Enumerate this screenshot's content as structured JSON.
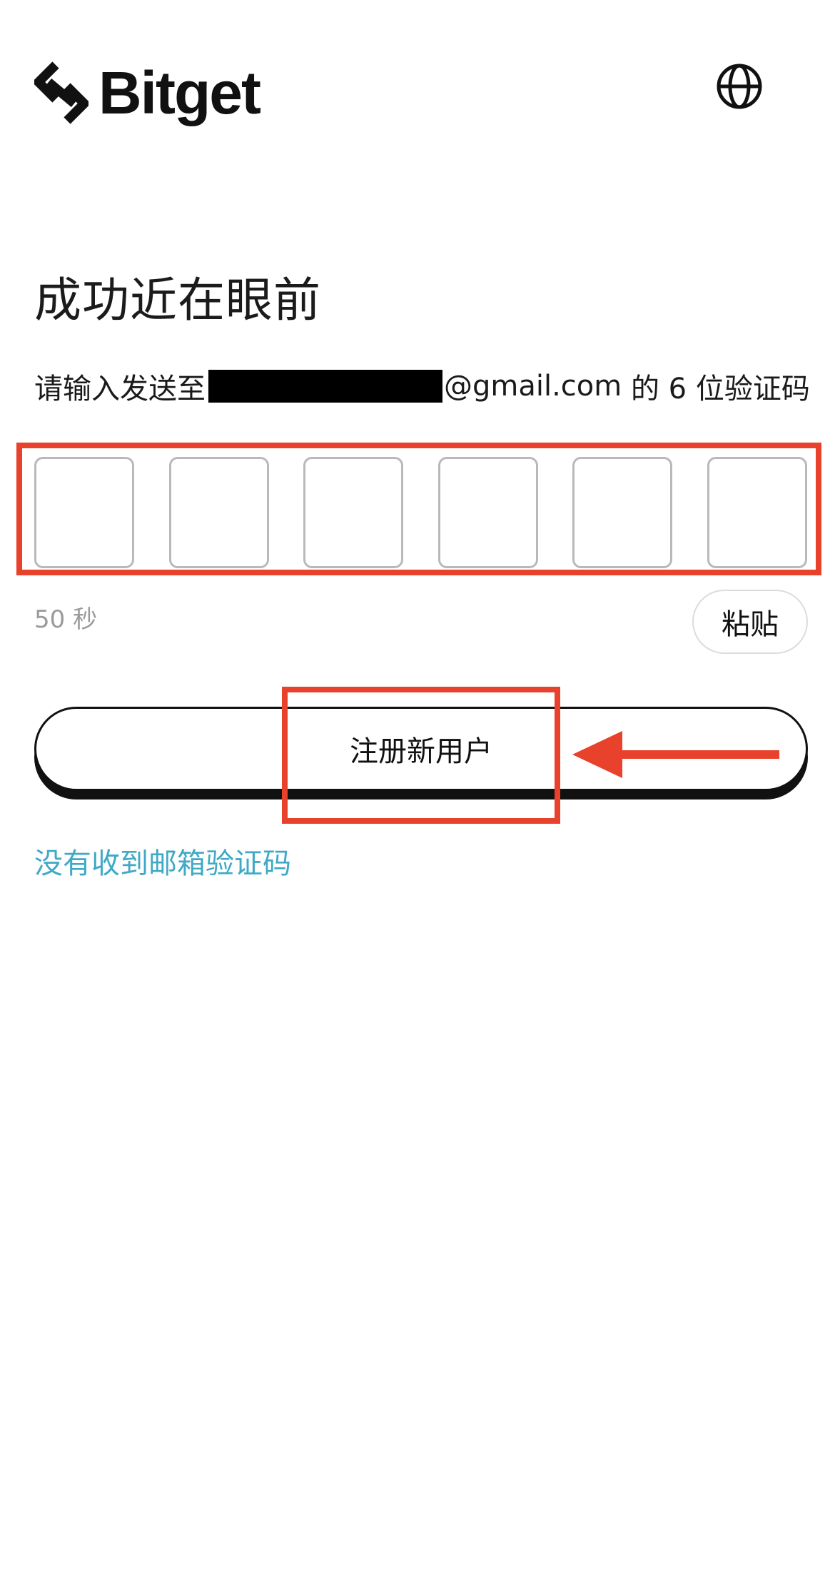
{
  "brand": {
    "name": "Bitget"
  },
  "header": {
    "language_icon": "globe-icon"
  },
  "title": "成功近在眼前",
  "subtitle": {
    "prefix": "请输入发送至",
    "email_suffix": "@gmail.com",
    "suffix": " 的 6 位验证码"
  },
  "otp": {
    "digits": [
      "",
      "",
      "",
      "",
      "",
      ""
    ]
  },
  "countdown": "50 秒",
  "paste_label": "粘贴",
  "register_label": "注册新用户",
  "no_code_label": "没有收到邮箱验证码",
  "colors": {
    "annotation": "#e8412c",
    "link": "#3fa9c6",
    "muted": "#9a9a9a"
  }
}
